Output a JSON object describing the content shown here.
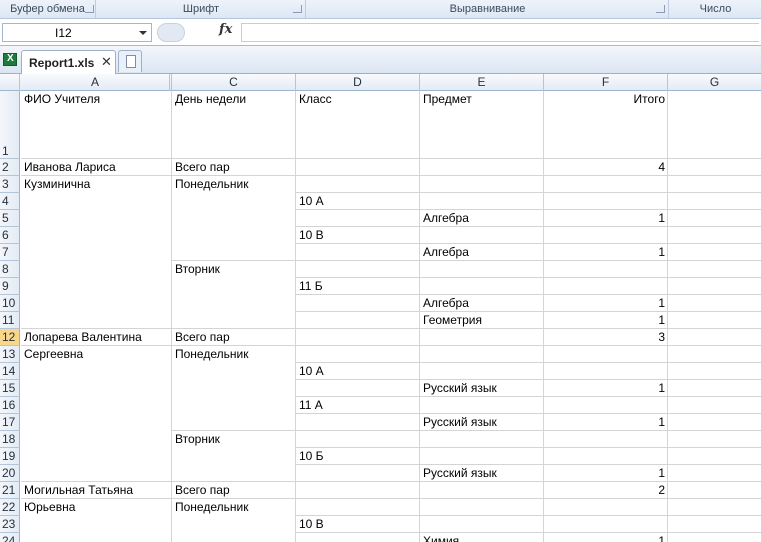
{
  "ribbon": {
    "groups": [
      "Буфер обмена",
      "Шрифт",
      "Выравнивание",
      "Число"
    ]
  },
  "formula_bar": {
    "name_box": "I12",
    "fx_icon": "fx-icon",
    "formula": ""
  },
  "tabs": {
    "file_tab": "Report1.xls",
    "close_icon": "close-icon",
    "new_tab_icon": "new-sheet-icon"
  },
  "columns": [
    "A",
    "",
    "C",
    "D",
    "E",
    "F",
    "G"
  ],
  "selected_row": 12,
  "rows": [
    {
      "n": "1",
      "A": "ФИО Учителя",
      "C": "День недели",
      "D": "Класс",
      "E": "Предмет",
      "F": "Итого"
    },
    {
      "n": "2",
      "A": "Иванова Лариса",
      "C": "Всего пар",
      "D": "",
      "E": "",
      "F": "4"
    },
    {
      "n": "3",
      "A": "Кузминична",
      "C": "Понедельник",
      "D": "",
      "E": "",
      "F": ""
    },
    {
      "n": "4",
      "A": "",
      "C": "",
      "D": "10 А",
      "E": "",
      "F": ""
    },
    {
      "n": "5",
      "A": "",
      "C": "",
      "D": "",
      "E": "Алгебра",
      "F": "1"
    },
    {
      "n": "6",
      "A": "",
      "C": "",
      "D": "10 В",
      "E": "",
      "F": ""
    },
    {
      "n": "7",
      "A": "",
      "C": "",
      "D": "",
      "E": "Алгебра",
      "F": "1"
    },
    {
      "n": "8",
      "A": "",
      "C": "Вторник",
      "D": "",
      "E": "",
      "F": ""
    },
    {
      "n": "9",
      "A": "",
      "C": "",
      "D": "11 Б",
      "E": "",
      "F": ""
    },
    {
      "n": "10",
      "A": "",
      "C": "",
      "D": "",
      "E": "Алгебра",
      "F": "1"
    },
    {
      "n": "11",
      "A": "",
      "C": "",
      "D": "",
      "E": "Геометрия",
      "F": "1"
    },
    {
      "n": "12",
      "A": "Лопарева Валентина",
      "C": "Всего пар",
      "D": "",
      "E": "",
      "F": "3"
    },
    {
      "n": "13",
      "A": "Сергеевна",
      "C": "Понедельник",
      "D": "",
      "E": "",
      "F": ""
    },
    {
      "n": "14",
      "A": "",
      "C": "",
      "D": "10 А",
      "E": "",
      "F": ""
    },
    {
      "n": "15",
      "A": "",
      "C": "",
      "D": "",
      "E": "Русский язык",
      "F": "1"
    },
    {
      "n": "16",
      "A": "",
      "C": "",
      "D": "11 А",
      "E": "",
      "F": ""
    },
    {
      "n": "17",
      "A": "",
      "C": "",
      "D": "",
      "E": "Русский язык",
      "F": "1"
    },
    {
      "n": "18",
      "A": "",
      "C": "Вторник",
      "D": "",
      "E": "",
      "F": ""
    },
    {
      "n": "19",
      "A": "",
      "C": "",
      "D": "10 Б",
      "E": "",
      "F": ""
    },
    {
      "n": "20",
      "A": "",
      "C": "",
      "D": "",
      "E": "Русский язык",
      "F": "1"
    },
    {
      "n": "21",
      "A": "Могильная Татьяна",
      "C": "Всего пар",
      "D": "",
      "E": "",
      "F": "2"
    },
    {
      "n": "22",
      "A": "Юрьевна",
      "C": "Понедельник",
      "D": "",
      "E": "",
      "F": ""
    },
    {
      "n": "23",
      "A": "",
      "C": "",
      "D": "10 В",
      "E": "",
      "F": ""
    },
    {
      "n": "24",
      "A": "",
      "C": "",
      "D": "",
      "E": "Химия",
      "F": "1"
    }
  ]
}
